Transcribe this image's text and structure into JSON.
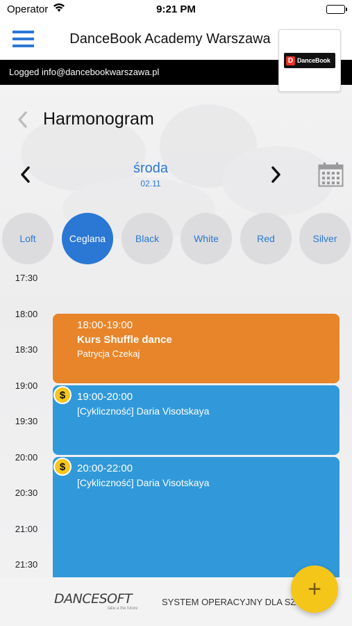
{
  "status_bar": {
    "carrier": "Operator",
    "time": "9:21 PM"
  },
  "header": {
    "title": "DanceBook Academy Warszawa",
    "logged_text": "Logged info@dancebookwarszawa.pl",
    "logo_text": "DanceBook",
    "logo_letter": "D"
  },
  "page": {
    "title": "Harmonogram"
  },
  "day_nav": {
    "day_name": "środa",
    "date": "02.11"
  },
  "rooms": [
    {
      "label": "Loft",
      "active": false
    },
    {
      "label": "Ceglana",
      "active": true
    },
    {
      "label": "Black",
      "active": false
    },
    {
      "label": "White",
      "active": false
    },
    {
      "label": "Red",
      "active": false
    },
    {
      "label": "Silver",
      "active": false
    }
  ],
  "time_slots": [
    "17:30",
    "18:00",
    "18:30",
    "19:00",
    "19:30",
    "20:00",
    "20:30",
    "21:00",
    "21:30"
  ],
  "events": [
    {
      "time": "18:00-19:00",
      "title": "Kurs Shuffle dance",
      "subtitle": "Patrycja Czekaj",
      "color": "#e8852a",
      "paid": false
    },
    {
      "time": "19:00-20:00",
      "title": "",
      "subtitle": "[Cykliczność] Daria Visotskaya",
      "color": "#3199da",
      "paid": true,
      "paid_symbol": "$"
    },
    {
      "time": "20:00-22:00",
      "title": "",
      "subtitle": "[Cykliczność] Daria Visotskaya",
      "color": "#3199da",
      "paid": true,
      "paid_symbol": "$"
    }
  ],
  "footer": {
    "brand": "DANCESOFT",
    "brand_sub": "take a the future",
    "tagline": "SYSTEM OPERACYJNY DLA SZKÓŁ TAŃCA"
  },
  "fab": {
    "label": "+"
  },
  "colors": {
    "accent": "#2a77d4",
    "orange": "#e8852a",
    "blue": "#3199da",
    "yellow": "#f4c61a"
  }
}
